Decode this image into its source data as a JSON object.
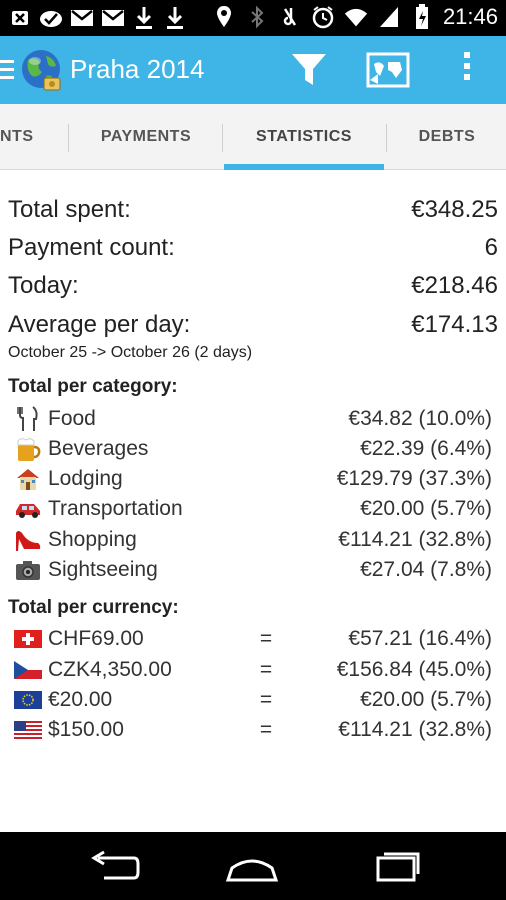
{
  "status_bar": {
    "time": "21:46",
    "left_icons": [
      "close-notification-icon",
      "checkmark-cloud-icon",
      "gmail-icon",
      "gmail-icon",
      "download-icon",
      "download-icon"
    ],
    "right_icons": [
      "location-icon",
      "bluetooth-icon",
      "mute-icon",
      "alarm-icon",
      "wifi-icon",
      "signal-icon",
      "battery-icon"
    ]
  },
  "action_bar": {
    "title": "Praha 2014",
    "background": "#3fb4e6"
  },
  "tabs": [
    {
      "label": "NTS"
    },
    {
      "label": "PAYMENTS"
    },
    {
      "label": "STATISTICS",
      "selected": true
    },
    {
      "label": "DEBTS"
    }
  ],
  "summary": {
    "total_spent_label": "Total spent:",
    "total_spent_value": "€348.25",
    "payment_count_label": "Payment count:",
    "payment_count_value": "6",
    "today_label": "Today:",
    "today_value": "€218.46",
    "avg_label": "Average per day:",
    "avg_value": "€174.13",
    "date_range": "October 25 -> October 26 (2 days)"
  },
  "categories": {
    "title": "Total per category:",
    "items": [
      {
        "icon": "fork-knife-icon",
        "name": "Food",
        "value": "€34.82 (10.0%)"
      },
      {
        "icon": "beer-mug-icon",
        "name": "Beverages",
        "value": "€22.39 (6.4%)"
      },
      {
        "icon": "house-icon",
        "name": "Lodging",
        "value": "€129.79 (37.3%)"
      },
      {
        "icon": "car-icon",
        "name": "Transportation",
        "value": "€20.00 (5.7%)"
      },
      {
        "icon": "high-heel-icon",
        "name": "Shopping",
        "value": "€114.21 (32.8%)"
      },
      {
        "icon": "camera-icon",
        "name": "Sightseeing",
        "value": "€27.04 (7.8%)"
      }
    ]
  },
  "currencies": {
    "title": "Total per currency:",
    "items": [
      {
        "flag": "swiss-flag-icon",
        "amount": "CHF69.00",
        "eq": "=",
        "value": "€57.21 (16.4%)"
      },
      {
        "flag": "czech-flag-icon",
        "amount": "CZK4,350.00",
        "eq": "=",
        "value": "€156.84 (45.0%)"
      },
      {
        "flag": "eu-flag-icon",
        "amount": "€20.00",
        "eq": "=",
        "value": "€20.00 (5.7%)"
      },
      {
        "flag": "us-flag-icon",
        "amount": "$150.00",
        "eq": "=",
        "value": "€114.21 (32.8%)"
      }
    ]
  },
  "nav_bar": {
    "icons": [
      "back-icon",
      "home-icon",
      "recent-apps-icon"
    ]
  }
}
